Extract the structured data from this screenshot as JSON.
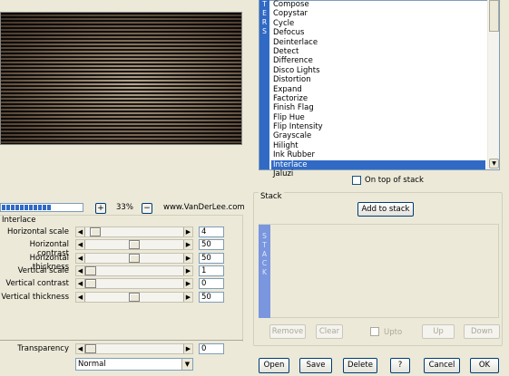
{
  "filter_list": {
    "tab_letters": [
      "T",
      "E",
      "R",
      "S"
    ],
    "items": [
      "Compose",
      "Copystar",
      "Cycle",
      "Defocus",
      "Deinterlace",
      "Detect",
      "Difference",
      "Disco Lights",
      "Distortion",
      "Expand",
      "Factorize",
      "Finish Flag",
      "Flip Hue",
      "Flip Intensity",
      "Grayscale",
      "Hilight",
      "Ink Rubber",
      "Interlace",
      "Jaluzi"
    ],
    "selected": "Interlace"
  },
  "on_top_of_stack": {
    "label": "On top of stack",
    "checked": false
  },
  "zoom": {
    "plus": "+",
    "minus": "−",
    "value": "33%",
    "progress_fraction": 0.6
  },
  "website": "www.VanDerLee.com",
  "interlace": {
    "title": "Interlace",
    "params": [
      {
        "label": "Horizontal scale",
        "value": "4",
        "level": 0.05
      },
      {
        "label": "Horizontal contrast",
        "value": "50",
        "level": 0.5
      },
      {
        "label": "Horizontal thickness",
        "value": "50",
        "level": 0.5
      },
      {
        "label": "Vertical scale",
        "value": "1",
        "level": 0.0
      },
      {
        "label": "Vertical contrast",
        "value": "0",
        "level": 0.0
      },
      {
        "label": "Vertical thickness",
        "value": "50",
        "level": 0.5
      }
    ]
  },
  "transparency": {
    "label": "Transparency",
    "value": "0",
    "level": 0.0
  },
  "blend_mode": {
    "selected": "Normal"
  },
  "stack": {
    "title": "Stack",
    "add_label": "Add to stack",
    "bar_letters": [
      "S",
      "T",
      "A",
      "C",
      "K"
    ],
    "remove_label": "Remove",
    "clear_label": "Clear",
    "upto_label": "Upto",
    "up_label": "Up",
    "down_label": "Down"
  },
  "footer": {
    "open_label": "Open",
    "save_label": "Save",
    "delete_label": "Delete",
    "help_label": "?",
    "cancel_label": "Cancel",
    "ok_label": "OK"
  },
  "icons": {
    "scroll_left": "arrow-left-icon",
    "scroll_right": "arrow-right-icon",
    "dropdown": "chevron-down-icon"
  },
  "colors": {
    "selection": "#316ac5",
    "stack_bar": "#7a96df",
    "background": "#ece9d8"
  }
}
